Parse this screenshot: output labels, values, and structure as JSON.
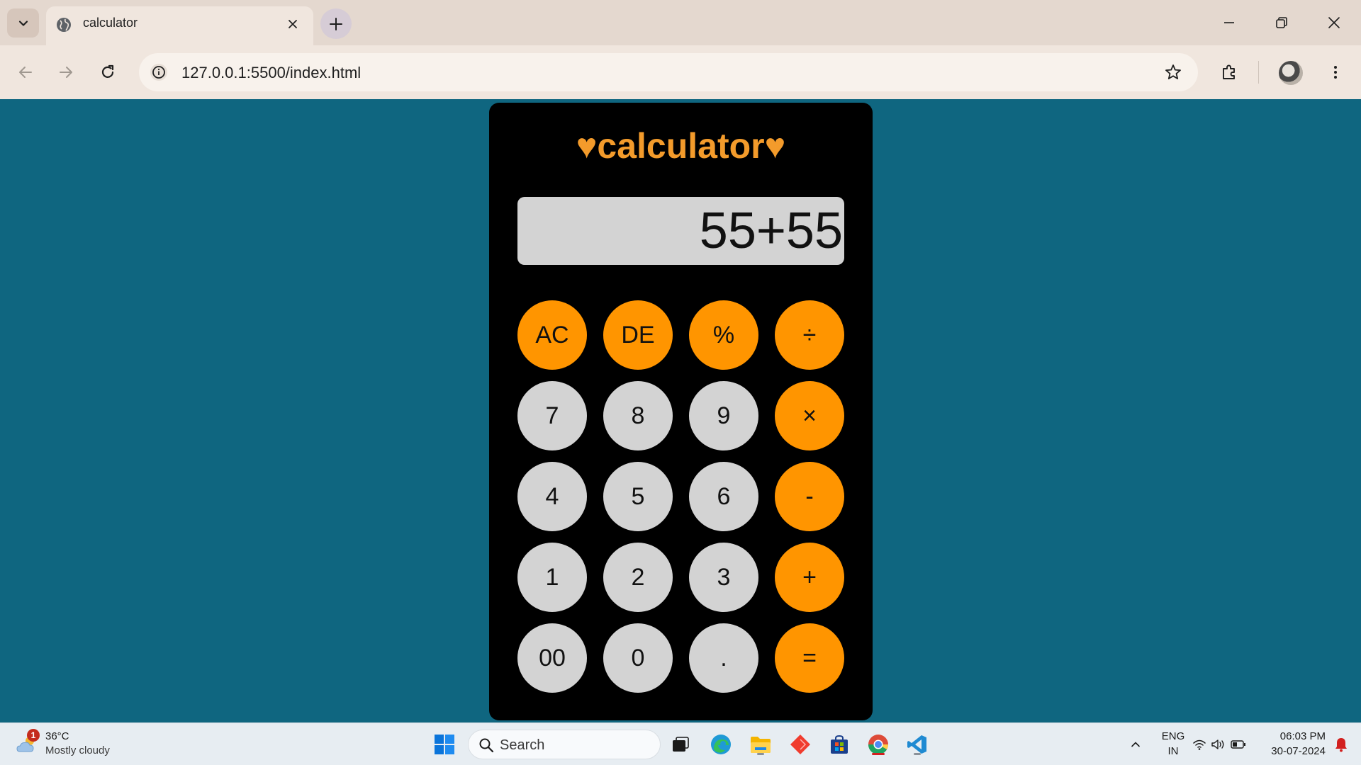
{
  "browser": {
    "tab_title": "calculator",
    "url": "127.0.0.1:5500/index.html"
  },
  "calculator": {
    "title": "♥calculator♥",
    "display": "55+55",
    "colors": {
      "operator": "#ff9500",
      "number": "#d3d3d3",
      "title": "#f39b2b",
      "body": "#000000",
      "page": "#0f6680"
    },
    "keys": [
      [
        "AC",
        "DE",
        "%",
        "÷"
      ],
      [
        "7",
        "8",
        "9",
        "×"
      ],
      [
        "4",
        "5",
        "6",
        "-"
      ],
      [
        "1",
        "2",
        "3",
        "+"
      ],
      [
        "00",
        "0",
        ".",
        "="
      ]
    ]
  },
  "taskbar": {
    "weather_badge": "1",
    "weather_temp": "36°C",
    "weather_desc": "Mostly cloudy",
    "search_label": "Search",
    "lang_top": "ENG",
    "lang_bottom": "IN",
    "time": "06:03 PM",
    "date": "30-07-2024"
  }
}
